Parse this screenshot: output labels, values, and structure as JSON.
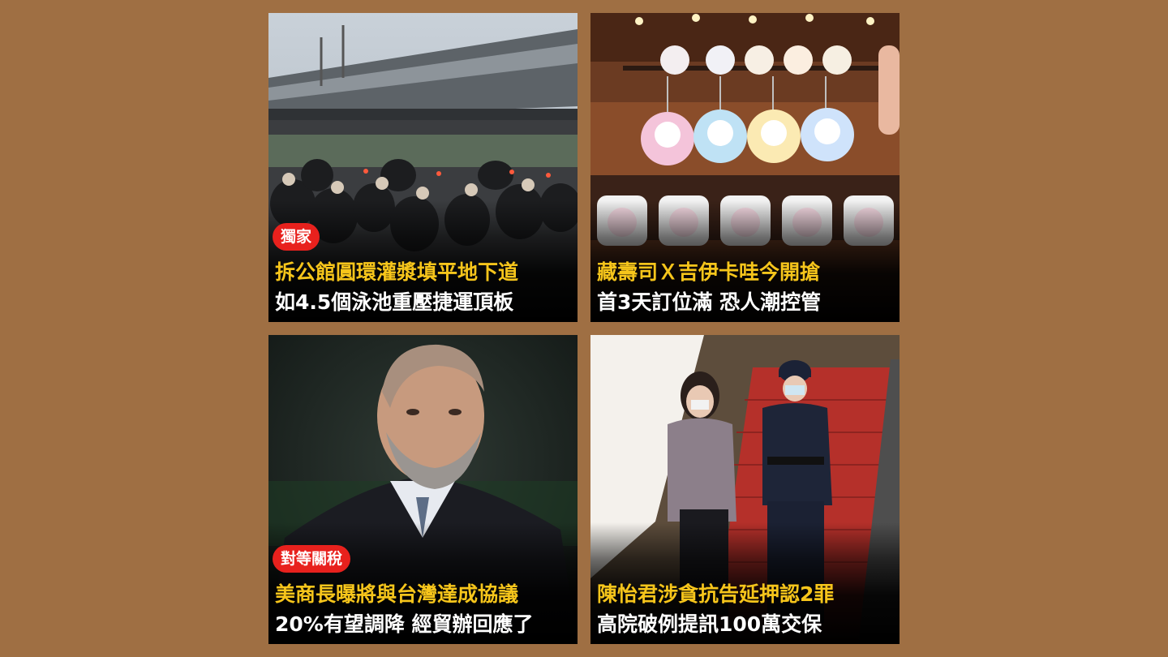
{
  "background_color": "#9f6f43",
  "accent_colors": {
    "headline_yellow": "#f6c51b",
    "headline_white": "#ffffff",
    "tag_red": "#e8211d"
  },
  "cards": [
    {
      "image": "overpass-scooter-traffic-photo",
      "tag": "獨家",
      "line1": "拆公館圓環灌漿填平地下道",
      "line2": "如4.5個泳池重壓捷運頂板"
    },
    {
      "image": "sanrio-keychain-badges-photo",
      "tag": "",
      "line1": "藏壽司Ｘ吉伊卡哇今開搶",
      "line2": "首3天訂位滿 恐人潮控管"
    },
    {
      "image": "man-in-suit-portrait-photo",
      "tag": "對等關稅",
      "line1": "美商長曝將與台灣達成協議",
      "line2": "20%有望調降 經貿辦回應了"
    },
    {
      "image": "woman-escorted-by-police-photo",
      "tag": "",
      "line1": "陳怡君涉貪抗告延押認2罪",
      "line2": "高院破例提訊100萬交保"
    }
  ]
}
